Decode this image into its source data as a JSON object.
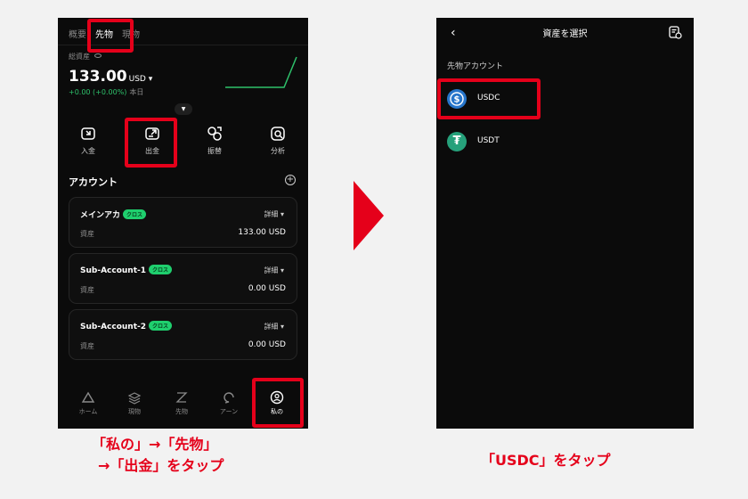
{
  "left_phone": {
    "top_tabs": [
      "概要",
      "先物",
      "現物"
    ],
    "active_tab": "先物",
    "total_assets_label": "総資産",
    "balance": "133.00",
    "balance_currency": "USD ▾",
    "change": "+0.00 (+0.00%)",
    "change_period": "本日",
    "actions": [
      {
        "label": "入金",
        "icon": "deposit-icon"
      },
      {
        "label": "出金",
        "icon": "withdraw-icon"
      },
      {
        "label": "振替",
        "icon": "transfer-icon"
      },
      {
        "label": "分析",
        "icon": "analysis-icon"
      }
    ],
    "accounts_title": "アカウント",
    "accounts": [
      {
        "name": "メインアカ",
        "badge": "クロス",
        "detail": "詳細 ▾",
        "asset_label": "資産",
        "asset_value": "133.00 USD"
      },
      {
        "name": "Sub-Account-1",
        "badge": "クロス",
        "detail": "詳細 ▾",
        "asset_label": "資産",
        "asset_value": "0.00 USD"
      },
      {
        "name": "Sub-Account-2",
        "badge": "クロス",
        "detail": "詳細 ▾",
        "asset_label": "資産",
        "asset_value": "0.00 USD"
      }
    ],
    "bottom_nav": [
      {
        "label": "ホーム",
        "icon": "home-icon"
      },
      {
        "label": "現物",
        "icon": "spot-icon"
      },
      {
        "label": "先物",
        "icon": "futures-icon"
      },
      {
        "label": "アーン",
        "icon": "earn-icon"
      },
      {
        "label": "私の",
        "icon": "profile-icon"
      }
    ],
    "active_nav": "私の"
  },
  "right_phone": {
    "title": "資産を選択",
    "section_label": "先物アカウント",
    "coins": [
      {
        "name": "USDC",
        "icon": "usdc-icon"
      },
      {
        "name": "USDT",
        "icon": "usdt-icon"
      }
    ]
  },
  "captions": {
    "left_line1": "「私の」→「先物」",
    "left_line2": "→「出金」をタップ",
    "right": "「USDC」をタップ"
  },
  "colors": {
    "highlight": "#e5001a",
    "positive": "#2ec16b",
    "badge": "#1fcf6e",
    "background": "#0b0b0b"
  }
}
